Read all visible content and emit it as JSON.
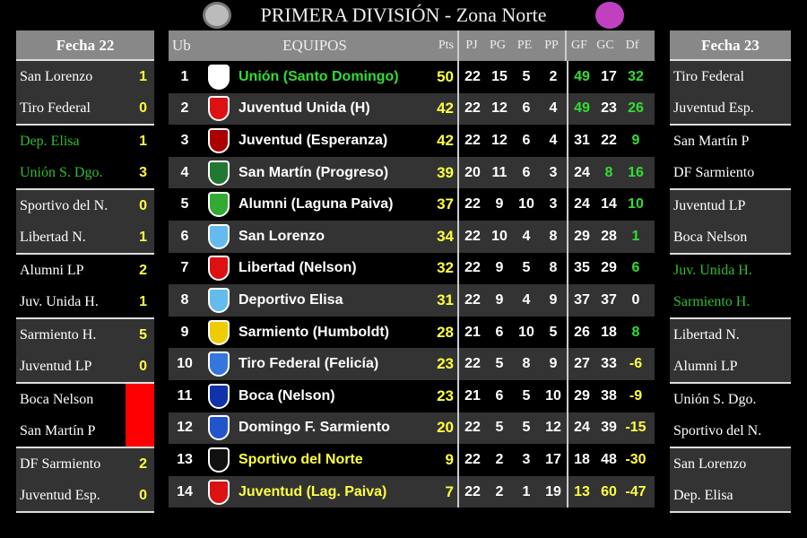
{
  "title": "PRIMERA DIVISIÓN - Zona Norte",
  "colors": {
    "green": "#33dd33",
    "yellow": "#ffff40",
    "white": "#ffffff",
    "red": "#ff0000"
  },
  "left": {
    "header": "Fecha 22",
    "matches": [
      {
        "home": "San Lorenzo",
        "hs": "1",
        "away": "Tiro Federal",
        "as": "0",
        "color": "#ffffff"
      },
      {
        "home": "Dep. Elisa",
        "hs": "1",
        "away": "Unión S. Dgo.",
        "as": "3",
        "color": "#33bb33"
      },
      {
        "home": "Sportivo del N.",
        "hs": "0",
        "away": "Libertad N.",
        "as": "1",
        "color": "#ffffff"
      },
      {
        "home": "Alumni LP",
        "hs": "2",
        "away": "Juv. Unida H.",
        "as": "1",
        "color": "#ffffff"
      },
      {
        "home": "Sarmiento H.",
        "hs": "5",
        "away": "Juventud LP",
        "as": "0",
        "color": "#ffffff"
      },
      {
        "home": "Boca Nelson",
        "hs": "",
        "away": "San Martín P",
        "as": "",
        "color": "#ffffff",
        "pending": true
      },
      {
        "home": "DF Sarmiento",
        "hs": "2",
        "away": "Juventud Esp.",
        "as": "0",
        "color": "#ffffff"
      }
    ]
  },
  "right": {
    "header": "Fecha 23",
    "matches": [
      {
        "home": "Tiro Federal",
        "away": "Juventud Esp.",
        "color": "#ffffff"
      },
      {
        "home": "San Martín P",
        "away": "DF Sarmiento",
        "color": "#ffffff"
      },
      {
        "home": "Juventud LP",
        "away": "Boca Nelson",
        "color": "#ffffff"
      },
      {
        "home": "Juv. Unida H.",
        "away": "Sarmiento H.",
        "color": "#33bb33"
      },
      {
        "home": "Libertad N.",
        "away": "Alumni LP",
        "color": "#ffffff"
      },
      {
        "home": "Unión S. Dgo.",
        "away": "Sportivo del N.",
        "color": "#ffffff"
      },
      {
        "home": "San Lorenzo",
        "away": "Dep. Elisa",
        "color": "#ffffff"
      }
    ]
  },
  "table": {
    "headers": [
      "Ub",
      "EQUIPOS",
      "Pts",
      "PJ",
      "PG",
      "PE",
      "PP",
      "GF",
      "GC",
      "Df"
    ],
    "rows": [
      {
        "ub": "1",
        "team": "Unión (Santo Domingo)",
        "pts": "50",
        "pj": "22",
        "pg": "15",
        "pe": "5",
        "pp": "2",
        "gf": "49",
        "gc": "17",
        "df": "32",
        "team_color": "green",
        "gf_color": "green",
        "gc_color": "white",
        "df_color": "green",
        "crest": "#ffffff"
      },
      {
        "ub": "2",
        "team": "Juventud Unida (H)",
        "pts": "42",
        "pj": "22",
        "pg": "12",
        "pe": "6",
        "pp": "4",
        "gf": "49",
        "gc": "23",
        "df": "26",
        "team_color": "white",
        "gf_color": "green",
        "gc_color": "white",
        "df_color": "green",
        "crest": "#dd1111"
      },
      {
        "ub": "3",
        "team": "Juventud (Esperanza)",
        "pts": "42",
        "pj": "22",
        "pg": "12",
        "pe": "6",
        "pp": "4",
        "gf": "31",
        "gc": "22",
        "df": "9",
        "team_color": "white",
        "gf_color": "white",
        "gc_color": "white",
        "df_color": "green",
        "crest": "#aa0000"
      },
      {
        "ub": "4",
        "team": "San Martín (Progreso)",
        "pts": "39",
        "pj": "20",
        "pg": "11",
        "pe": "6",
        "pp": "3",
        "gf": "24",
        "gc": "8",
        "df": "16",
        "team_color": "white",
        "gf_color": "white",
        "gc_color": "green",
        "df_color": "green",
        "crest": "#227733"
      },
      {
        "ub": "5",
        "team": "Alumni (Laguna Paiva)",
        "pts": "37",
        "pj": "22",
        "pg": "9",
        "pe": "10",
        "pp": "3",
        "gf": "24",
        "gc": "14",
        "df": "10",
        "team_color": "white",
        "gf_color": "white",
        "gc_color": "white",
        "df_color": "green",
        "crest": "#33aa33"
      },
      {
        "ub": "6",
        "team": "San Lorenzo",
        "pts": "34",
        "pj": "22",
        "pg": "10",
        "pe": "4",
        "pp": "8",
        "gf": "29",
        "gc": "28",
        "df": "1",
        "team_color": "white",
        "gf_color": "white",
        "gc_color": "white",
        "df_color": "green",
        "crest": "#66bbee"
      },
      {
        "ub": "7",
        "team": "Libertad (Nelson)",
        "pts": "32",
        "pj": "22",
        "pg": "9",
        "pe": "5",
        "pp": "8",
        "gf": "35",
        "gc": "29",
        "df": "6",
        "team_color": "white",
        "gf_color": "white",
        "gc_color": "white",
        "df_color": "green",
        "crest": "#dd1111"
      },
      {
        "ub": "8",
        "team": "Deportivo Elisa",
        "pts": "31",
        "pj": "22",
        "pg": "9",
        "pe": "4",
        "pp": "9",
        "gf": "37",
        "gc": "37",
        "df": "0",
        "team_color": "white",
        "gf_color": "white",
        "gc_color": "white",
        "df_color": "white",
        "crest": "#66bbee"
      },
      {
        "ub": "9",
        "team": "Sarmiento (Humboldt)",
        "pts": "28",
        "pj": "21",
        "pg": "6",
        "pe": "10",
        "pp": "5",
        "gf": "26",
        "gc": "18",
        "df": "8",
        "team_color": "white",
        "gf_color": "white",
        "gc_color": "white",
        "df_color": "green",
        "crest": "#eecc00"
      },
      {
        "ub": "10",
        "team": "Tiro Federal (Felicía)",
        "pts": "23",
        "pj": "22",
        "pg": "5",
        "pe": "8",
        "pp": "9",
        "gf": "27",
        "gc": "33",
        "df": "-6",
        "team_color": "white",
        "gf_color": "white",
        "gc_color": "white",
        "df_color": "yellow",
        "crest": "#3377dd"
      },
      {
        "ub": "11",
        "team": "Boca (Nelson)",
        "pts": "23",
        "pj": "21",
        "pg": "6",
        "pe": "5",
        "pp": "10",
        "gf": "29",
        "gc": "38",
        "df": "-9",
        "team_color": "white",
        "gf_color": "white",
        "gc_color": "white",
        "df_color": "yellow",
        "crest": "#1133aa"
      },
      {
        "ub": "12",
        "team": "Domingo F. Sarmiento",
        "pts": "20",
        "pj": "22",
        "pg": "5",
        "pe": "5",
        "pp": "12",
        "gf": "24",
        "gc": "39",
        "df": "-15",
        "team_color": "white",
        "gf_color": "white",
        "gc_color": "white",
        "df_color": "yellow",
        "crest": "#2255cc"
      },
      {
        "ub": "13",
        "team": "Sportivo del Norte",
        "pts": "9",
        "pj": "22",
        "pg": "2",
        "pe": "3",
        "pp": "17",
        "gf": "18",
        "gc": "48",
        "df": "-30",
        "team_color": "yellow",
        "gf_color": "white",
        "gc_color": "white",
        "df_color": "yellow",
        "crest": "#111111"
      },
      {
        "ub": "14",
        "team": "Juventud (Lag. Paiva)",
        "pts": "7",
        "pj": "22",
        "pg": "2",
        "pe": "1",
        "pp": "19",
        "gf": "13",
        "gc": "60",
        "df": "-47",
        "team_color": "yellow",
        "gf_color": "yellow",
        "gc_color": "yellow",
        "df_color": "yellow",
        "crest": "#dd1111"
      }
    ]
  }
}
